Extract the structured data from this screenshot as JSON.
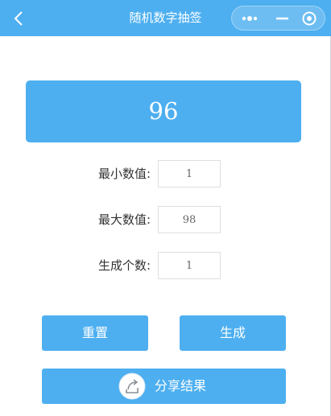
{
  "header": {
    "title": "随机数字抽签",
    "back_icon": "chevron-left-icon",
    "more_icon": "more-dots-icon",
    "minimize_icon": "minimize-icon",
    "close_icon": "close-circle-icon",
    "color": "#4daff0"
  },
  "result": {
    "value": "96"
  },
  "form": {
    "min_label": "最小数值:",
    "min_value": "1",
    "max_label": "最大数值:",
    "max_value": "98",
    "count_label": "生成个数:",
    "count_value": "1"
  },
  "buttons": {
    "reset_label": "重置",
    "generate_label": "生成",
    "share_label": "分享结果",
    "share_icon": "share-arrow-icon"
  },
  "colors": {
    "accent": "#4daff0",
    "text": "#333333"
  }
}
